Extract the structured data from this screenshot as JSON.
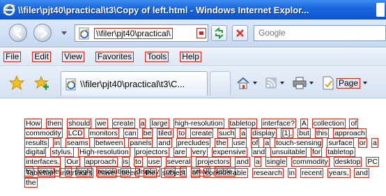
{
  "window": {
    "title": "\\\\filer\\pjt40\\practical\\t3\\Copy of left.html - Windows Internet Explor..."
  },
  "address": {
    "url": "\\\\filer\\pjt40\\practical\\",
    "search_placeholder": "Google"
  },
  "menu": {
    "items": [
      "File",
      "Edit",
      "View",
      "Favorites",
      "Tools",
      "Help"
    ]
  },
  "tab": {
    "label": "\\\\filer\\pjt40\\practical\\t3\\C...",
    "page_label": "Page"
  },
  "content": {
    "paragraph1": [
      "How",
      "then",
      "should",
      "we",
      "create",
      "a",
      "large",
      "high-resolution",
      "tabletop",
      "interface?",
      "A",
      "collection",
      "of",
      "commodity",
      "LCD",
      "monitors",
      "can",
      "be",
      "tiled",
      "to",
      "create",
      "such",
      "a",
      "display",
      "[1],",
      "but",
      "this",
      "approach",
      "results",
      "in",
      "seams",
      "between",
      "panels",
      "and",
      "precludes",
      "the",
      "use",
      "of",
      "a",
      "touch-sensing",
      "surface",
      "or",
      "a",
      "digital",
      "stylus.",
      "High-resolution",
      "projectors",
      "are",
      "very",
      "expensive",
      "and",
      "unsuitable",
      "for",
      "tabletop",
      "interfaces.",
      "Our",
      "approach",
      "is",
      "to",
      "use",
      "several",
      "projectors",
      "and",
      "a",
      "single",
      "commodity",
      "desktop",
      "PC",
      "to",
      "create",
      "a",
      "high",
      "resolution",
      "display",
      "on",
      "a",
      "small",
      "table."
    ],
    "paragraph2": [
      "Tabletop",
      "interfaces",
      "have",
      "been",
      "the",
      "subject",
      "of",
      "considerable",
      "research",
      "in",
      "recent",
      "years,",
      "and",
      "the"
    ]
  }
}
